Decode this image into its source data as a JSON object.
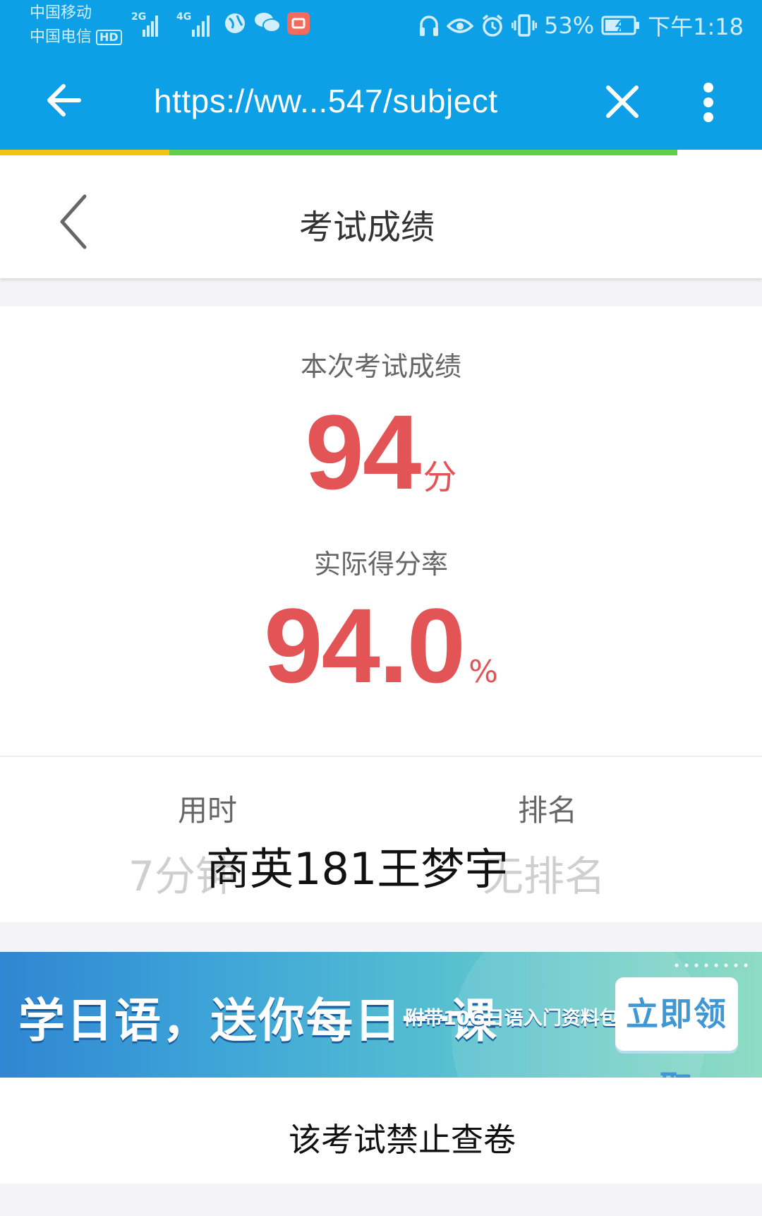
{
  "status_bar": {
    "carrier_1": "中国移动",
    "carrier_2": "中国电信",
    "hd_badge": "HD",
    "net_1": "2G",
    "net_2": "4G",
    "battery": "53%",
    "time": "下午1:18"
  },
  "browser": {
    "url": "https://ww...547/subject"
  },
  "header": {
    "title": "考试成绩"
  },
  "score": {
    "label": "本次考试成绩",
    "value": "94",
    "unit": "分",
    "rate_label": "实际得分率",
    "rate_value": "94.0",
    "rate_unit": "%"
  },
  "stats": {
    "time_label": "用时",
    "time_value": "7分钟",
    "rank_label": "排名",
    "rank_value": "无排名",
    "watermark": "商英181王梦宇"
  },
  "banner": {
    "main_text": "学日语，送你每日一课",
    "sub_text": "附带10G日语入门资料包",
    "button_label": "立即领取"
  },
  "notice": {
    "text": "该考试禁止查卷"
  },
  "colors": {
    "browser_bar": "#0ea0e6",
    "score_red": "#e25456"
  }
}
